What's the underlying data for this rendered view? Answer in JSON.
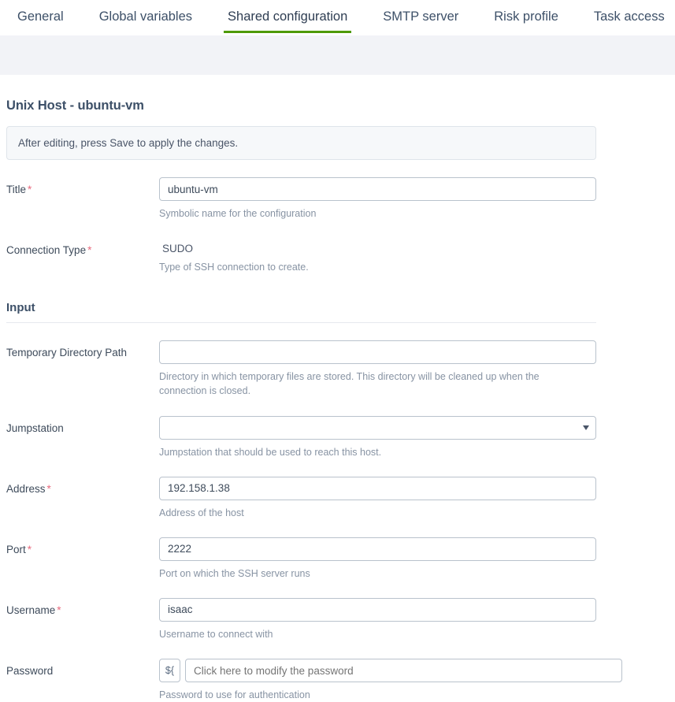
{
  "tabs": [
    {
      "label": "General",
      "active": false
    },
    {
      "label": "Global variables",
      "active": false
    },
    {
      "label": "Shared configuration",
      "active": true
    },
    {
      "label": "SMTP server",
      "active": false
    },
    {
      "label": "Risk profile",
      "active": false
    },
    {
      "label": "Task access",
      "active": false
    }
  ],
  "page": {
    "title": "Unix Host - ubuntu-vm",
    "info_banner": "After editing, press Save to apply the changes."
  },
  "fields": {
    "title": {
      "label": "Title",
      "required": true,
      "value": "ubuntu-vm",
      "help": "Symbolic name for the configuration"
    },
    "connection_type": {
      "label": "Connection Type",
      "required": true,
      "value": "SUDO",
      "help": "Type of SSH connection to create."
    },
    "temporary_directory_path": {
      "label": "Temporary Directory Path",
      "required": false,
      "value": "",
      "help": "Directory in which temporary files are stored. This directory will be cleaned up when the connection is closed."
    },
    "jumpstation": {
      "label": "Jumpstation",
      "required": false,
      "value": "",
      "help": "Jumpstation that should be used to reach this host."
    },
    "address": {
      "label": "Address",
      "required": true,
      "value": "192.158.1.38",
      "help": "Address of the host"
    },
    "port": {
      "label": "Port",
      "required": true,
      "value": "2222",
      "help": "Port on which the SSH server runs"
    },
    "username": {
      "label": "Username",
      "required": true,
      "value": "isaac",
      "help": "Username to connect with"
    },
    "password": {
      "label": "Password",
      "required": false,
      "value": "",
      "placeholder": "Click here to modify the password",
      "help": "Password to use for authentication",
      "variable_button_label": "${"
    }
  },
  "sections": {
    "input": {
      "title": "Input"
    }
  },
  "colors": {
    "active_tab_underline": "#4e9a06",
    "required_marker": "#e8697d",
    "band": "#f2f3f7",
    "text": "#3e4b5b",
    "help_text": "#8793a3"
  }
}
